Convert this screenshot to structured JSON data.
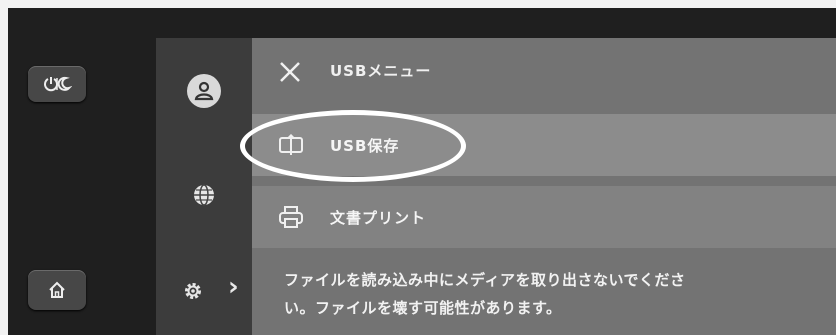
{
  "hardware": {
    "power_button": "power-sleep-icon",
    "home_button": "home-icon"
  },
  "nav_rail": {
    "items": [
      {
        "icon": "user-icon"
      },
      {
        "icon": "globe-icon"
      },
      {
        "icon": "gear-icon"
      }
    ]
  },
  "usb_menu": {
    "title": "USBメニュー",
    "close_icon": "close-icon",
    "items": [
      {
        "label": "USB保存",
        "icon": "usb-save-icon"
      },
      {
        "label": "文書プリント",
        "icon": "printer-icon"
      }
    ],
    "notice_lines": [
      "ファイルを読み込み中にメディアを取り出さないでくださ",
      "い。ファイルを壊す可能性があります。"
    ]
  },
  "colors": {
    "annotation_ring": "#ffffff",
    "panel_bg": "#737373",
    "rail_bg": "#3c3c3c"
  }
}
